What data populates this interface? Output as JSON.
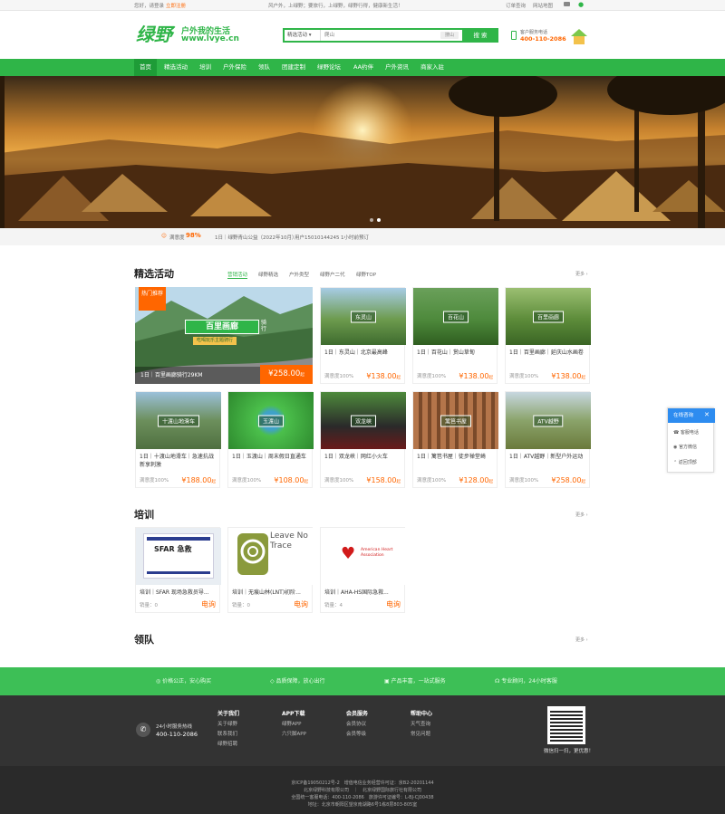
{
  "topbar": {
    "greeting": "您好，请登录",
    "register": "立即注册",
    "slogan": "风户外，上绿野；要旅行，上绿野，绿野行得，健康新生活！",
    "orders": "订单查询",
    "sitemap": "网站地图"
  },
  "header": {
    "logo_cn": "绿野",
    "logo_tagline": "户外我的生活",
    "logo_url": "www.lvye.cn",
    "search_category": "精选活动",
    "search_placeholder": "爬山",
    "search_tag": "搜山",
    "search_button": "搜 索",
    "hotline_label": "客户服务电话",
    "hotline_number": "400-110-2086"
  },
  "nav": [
    "首页",
    "精选活动",
    "培训",
    "户外保险",
    "领队",
    "团建定制",
    "绿野论坛",
    "AA约伴",
    "户外资讯",
    "商家入驻"
  ],
  "ticker": {
    "satisfaction_label": "满意度",
    "satisfaction_value": "98%",
    "item": "1日｜绿野青山公益（2022年10月）",
    "user": "用户15010144245",
    "time": "1小时前预订"
  },
  "activities": {
    "title": "精选活动",
    "tabs": [
      "营销活动",
      "绿野精选",
      "户外类型",
      "绿野户二代",
      "绿野TOP"
    ],
    "more": "更多 ›",
    "featured": {
      "badge": "热门推荐",
      "banner_text": "百里画廊",
      "banner_side": "骑行",
      "banner_sub": "吃喝玩乐主题骑行",
      "title": "1日｜百里画廊骑行29KM",
      "price": "¥258.00",
      "unit": "起"
    },
    "items": [
      {
        "label": "东灵山",
        "title": "1日｜东灵山｜北京最高峰",
        "sat": "满意度100%",
        "price": "¥138.00",
        "unit": "起"
      },
      {
        "label": "百花山",
        "title": "1日｜百花山｜赏山草甸",
        "sat": "满意度100%",
        "price": "¥138.00",
        "unit": "起"
      },
      {
        "label": "百里画廊",
        "title": "1日｜百里画廊｜延庆山水画卷",
        "sat": "满意度100%",
        "price": "¥138.00",
        "unit": "起"
      },
      {
        "label": "十渡山地滑车",
        "title": "1日｜十渡山地滑车｜急速抗战新享刺激",
        "sat": "满意度100%",
        "price": "¥188.00",
        "unit": "起"
      },
      {
        "label": "玉渡山",
        "title": "1日｜玉渡山｜周末假日直通车",
        "sat": "满意度100%",
        "price": "¥108.00",
        "unit": "起"
      },
      {
        "label": "双龙峡",
        "title": "1日｜双龙峡｜网红小火车",
        "sat": "满意度100%",
        "price": "¥158.00",
        "unit": "起"
      },
      {
        "label": "篱笆书屋",
        "title": "1日｜篱笆书屋｜徒步禅堂崎",
        "sat": "满意度100%",
        "price": "¥128.00",
        "unit": "起"
      },
      {
        "label": "ATV越野",
        "title": "1日｜ATV越野｜新型户外运动",
        "sat": "满意度100%",
        "price": "¥258.00",
        "unit": "起"
      }
    ]
  },
  "training": {
    "title": "培训",
    "more": "更多 ›",
    "items": [
      {
        "title": "培训｜SFAR 现场急救员导...",
        "sales": "销量：0",
        "price": "电询",
        "logo_text": "SFAR 急救"
      },
      {
        "title": "培训｜无痕山林(LNT)初阶...",
        "sales": "销量：0",
        "price": "电询",
        "logo_text": "Leave No Trace"
      },
      {
        "title": "培训｜AHA-HS国际急救...",
        "sales": "销量：4",
        "price": "电询",
        "logo_text": "American Heart Association"
      }
    ]
  },
  "leaders": {
    "title": "领队",
    "more": "更多 ›"
  },
  "features": [
    "价格公正，安心购买",
    "品质保障，放心出行",
    "产品丰富，一站式服务",
    "专业顾问，24小时客服"
  ],
  "footer": {
    "service_label": "24小时服务热线",
    "service_number": "400-110-2086",
    "cols": [
      {
        "head": "关于我们",
        "links": [
          "关于绿野",
          "联系我们",
          "绿野招聘"
        ]
      },
      {
        "head": "APP下载",
        "links": [
          "绿野APP",
          "六只脚APP"
        ]
      },
      {
        "head": "会员服务",
        "links": [
          "会员协议",
          "会员等级"
        ]
      },
      {
        "head": "帮助中心",
        "links": [
          "天气查询",
          "常见问题"
        ]
      }
    ],
    "qr_caption": "微信扫一扫，更优惠！",
    "bottom_lines": [
      "京ICP备19050212号-2　增值电信业务经营许可证：京B2-20201144",
      "北京绿野科技有限公司　｜　北京绿野国际旅行社有限公司",
      "全国统一客服电话：400-110-2086　旅游许可证编号：L-BJ-CJ00438",
      "地址：北京市朝阳区望京南湖路6号1栋8层803-805室"
    ]
  },
  "float_widget": {
    "head": "在线咨询",
    "phone": "客服电话",
    "wechat": "官方微信",
    "top": "返回顶部",
    "close": "✕"
  },
  "colors": {
    "brand_green": "#2fb548",
    "price_orange": "#ff6600",
    "footer_bg": "#333333"
  }
}
